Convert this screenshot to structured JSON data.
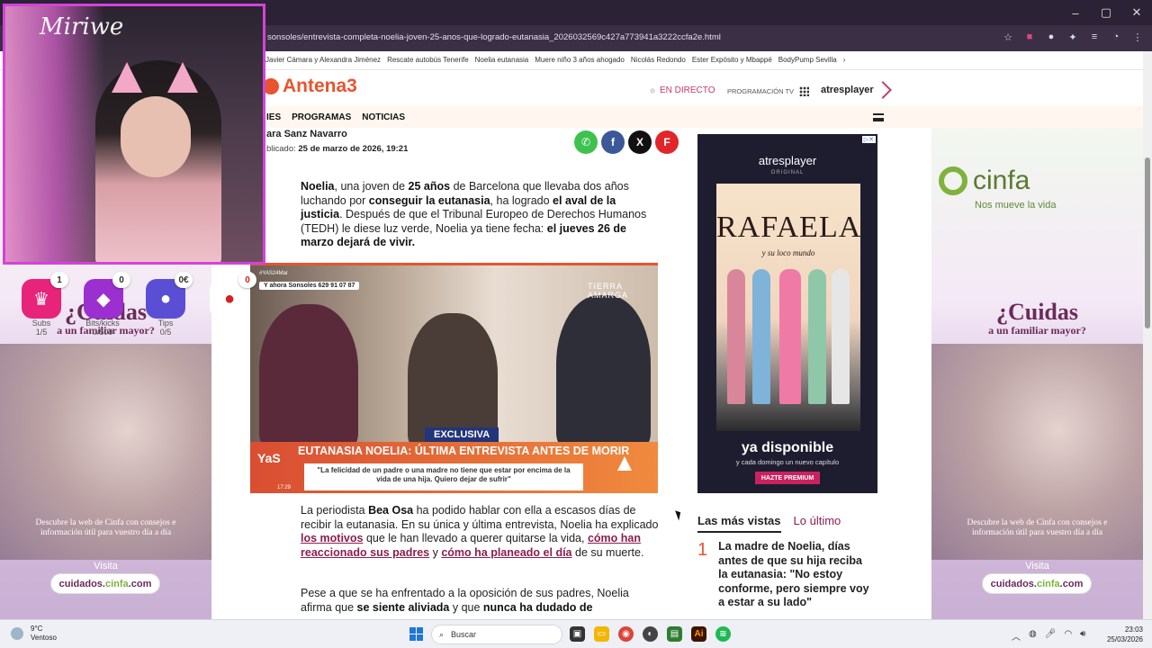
{
  "browser": {
    "url": "sonsoles/entrevista-completa-noelia-joven-25-anos-que-logrado-eutanasia_2026032569c427a773941a3222ccfa2e.html",
    "bookmarks": [
      "Javier Cámara y Alexandra Jiménez",
      "Rescate autobús Tenerife",
      "Noelia eutanasia",
      "Muere niño 3 años ahogado",
      "Nicolás Redondo",
      "Ester Expósito y Mbappé",
      "BodyPump Sevilla"
    ],
    "window_controls": [
      "–",
      "▢",
      "✕"
    ]
  },
  "site": {
    "logo": "Antena3",
    "directo": "EN DIRECTO",
    "programacion": "PROGRAMACIÓN TV",
    "atresplayer": "atresplayer",
    "nav": [
      "IES",
      "PROGRAMAS",
      "NOTICIAS"
    ]
  },
  "article": {
    "author": "ara Sanz Navarro",
    "published_label": "blicado:",
    "published_date": "25 de marzo de 2026, 19:21",
    "p1": {
      "a": "Noelia",
      "b": ", una joven de ",
      "c": "25 años",
      "d": " de Barcelona que llevaba dos años luchando por ",
      "e": "conseguir la eutanasia",
      "f": ", ha logrado ",
      "g": "el aval de la justicia",
      "h": ". Después de que el Tribunal Europeo de Derechos Humanos (TEDH) le diese luz verde, Noelia ya tiene fecha: ",
      "i": "el jueves 26 de marzo dejará de vivir."
    },
    "hero": {
      "hashtag": "#YAS24Mar",
      "chip": "Y ahora Sonsoles   629 91 07 87",
      "channel": "TIERRA AMARGA",
      "exclusive": "EXCLUSIVA",
      "headline": "EUTANASIA NOELIA: ÚLTIMA ENTREVISTA ANTES DE MORIR",
      "quote": "\"La felicidad de un padre o una madre no tiene que estar por encima de la vida de una hija. Quiero dejar de sufrir\"",
      "show": "YaS",
      "time": "17:29"
    },
    "p2": {
      "a": "La periodista ",
      "b": "Bea Osa",
      "c": " ha podido hablar con ella a escasos días de recibir la eutanasia. En su única y última entrevista, Noelia ha explicado ",
      "d": "los motivos",
      "e": " que le han llevado a querer quitarse la vida, ",
      "f": "cómo han reaccionado sus padres",
      "g": " y ",
      "h": "cómo ha planeado el día",
      "i": " de su muerte."
    },
    "p3": {
      "a": "Pese a que se ha enfrentado a la oposición de sus padres, Noelia afirma que ",
      "b": "se siente aliviada",
      "c": " y que ",
      "d": "nunca ha dudado de"
    }
  },
  "ad_cinfa": {
    "brand": "cinfa",
    "slogan": "Nos mueve la vida",
    "headline": "¿Cuidas",
    "subheadline": "a un familiar mayor?",
    "desc": "Descubre la web de Cinfa con consejos e información útil para vuestro día a día",
    "visit": "Visita",
    "url_a": "cuidados.",
    "url_b": "cinfa",
    "url_c": ".com"
  },
  "ad_atresplayer": {
    "brand": "atresplayer",
    "original": "ORIGINAL",
    "title": "RAFAELA",
    "subtitle": "y su loco mundo",
    "cta": "ya disponible",
    "cta2": "y cada domingo un nuevo capítulo",
    "button": "HAZTE PREMIUM"
  },
  "sidebar": {
    "tab_active": "Las más vistas",
    "tab_other": "Lo último",
    "item_num": "1",
    "item_text": "La madre de Noelia, días antes de que su hija reciba la eutanasia: \"No estoy conforme, pero siempre voy a estar a su lado\""
  },
  "stream": {
    "signature": "Miriwe",
    "widgets": [
      {
        "count": "1",
        "label": "Subs",
        "sub": "1/5"
      },
      {
        "count": "0",
        "label": "Bits/kicks",
        "sub": "0/500"
      },
      {
        "count": "0€",
        "label": "Tips",
        "sub": "0/5"
      },
      {
        "count": "0",
        "label": "",
        "sub": ""
      }
    ]
  },
  "taskbar": {
    "temp": "9°C",
    "weather": "Ventoso",
    "search": "Buscar",
    "time": "23:03",
    "date": "25/03/2026"
  },
  "colors": {
    "antena_orange": "#e8542e",
    "accent_purple": "#8a1f4f",
    "cinfa_green": "#7fb23d",
    "cam_border": "#d443d9"
  }
}
